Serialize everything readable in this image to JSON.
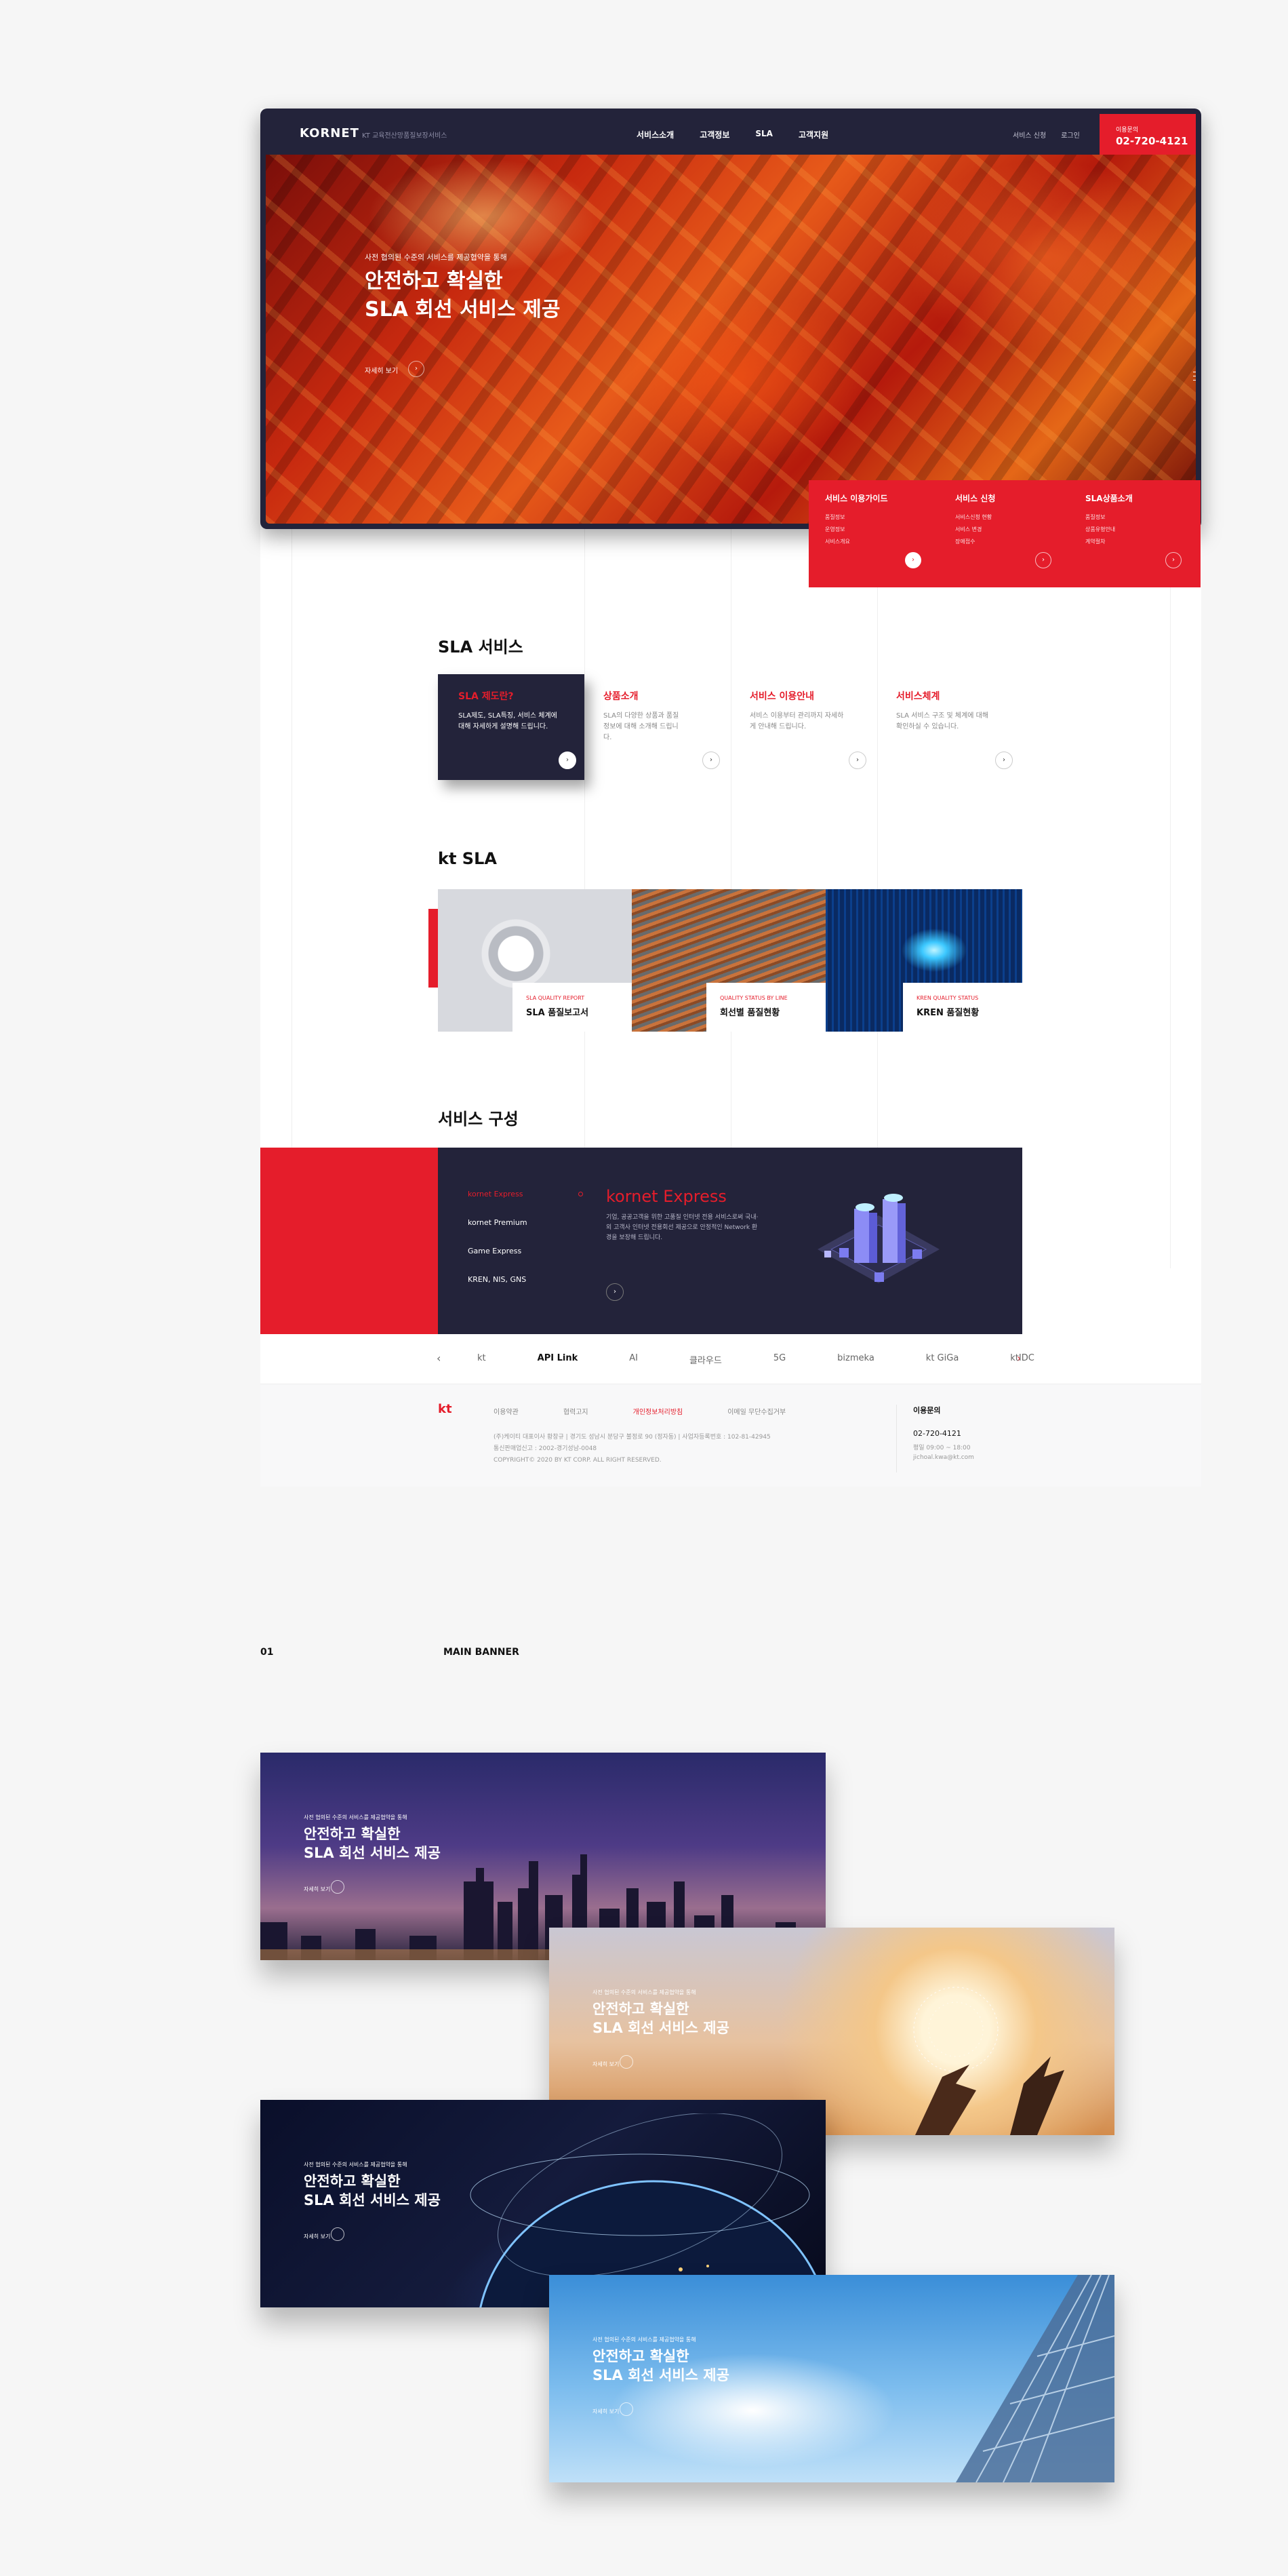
{
  "colors": {
    "accent": "#e51d2b",
    "navy": "#23233a"
  },
  "header": {
    "logo_text": "KORNET",
    "logo_sub": "KT 교육전산망품질보장서비스",
    "nav": [
      "서비스소개",
      "고객정보",
      "SLA",
      "고객지원"
    ],
    "util": [
      "서비스 신청",
      "로그인"
    ],
    "call_label": "이용문의",
    "call_number": "02-720-4121"
  },
  "hero": {
    "subtitle": "사전 협의된 수준의 서비스를 제공협약을 통해",
    "title": "안전하고 확실한\nSLA 회선 서비스 제공",
    "more": "자세히 보기"
  },
  "quick": [
    {
      "title": "서비스 이용가이드",
      "items": [
        "품질정보",
        "운영정보",
        "서비스개요"
      ]
    },
    {
      "title": "서비스 신청",
      "items": [
        "서비스신청 현황",
        "서비스 변경",
        "장애접수"
      ]
    },
    {
      "title": "SLA상품소개",
      "items": [
        "품질정보",
        "상품유형안내",
        "계약절차"
      ]
    }
  ],
  "sla": {
    "title": "SLA 서비스",
    "cards": [
      {
        "title": "SLA 제도란?",
        "desc": "SLA제도, SLA특징, 서비스 체계에 대해 자세하게 설명해 드립니다."
      },
      {
        "title": "상품소개",
        "desc": "SLA의 다양한 상품과 품질정보에 대해 소개해 드립니다."
      },
      {
        "title": "서비스 이용안내",
        "desc": "서비스 이용부터 관리까지 자세하게 안내해 드립니다."
      },
      {
        "title": "서비스체계",
        "desc": "SLA 서비스 구조 및 체계에 대해 확인하실 수 있습니다."
      }
    ]
  },
  "ktsla": {
    "title": "kt SLA",
    "tiles": [
      {
        "tag": "SLA QUALITY REPORT",
        "name": "SLA 품질보고서"
      },
      {
        "tag": "QUALITY STATUS BY LINE",
        "name": "회선별 품질현황"
      },
      {
        "tag": "KREN QUALITY STATUS",
        "name": "KREN 품질현황"
      }
    ]
  },
  "service": {
    "title": "서비스 구성",
    "menu": [
      "kornet Express",
      "kornet Premium",
      "Game Express",
      "KREN, NIS, GNS"
    ],
    "active_title": "kornet Express",
    "desc": "기업, 공공고객을 위한 고품질 인터넷 전용 서비스로써 국내·외 고객사 인터넷 전용회선 제공으로 안정적인 Network 환경을 보장해 드립니다."
  },
  "links": {
    "items": [
      "kt",
      "API Link",
      "AI",
      "클라우드",
      "5G",
      "bizmeka",
      "kt GiGa",
      "ktIDC"
    ],
    "prev": "‹",
    "next": "›"
  },
  "footer": {
    "logo": "kt",
    "nav": [
      "이용약관",
      "협력고지",
      "개인정보처리방침",
      "이메일 무단수집거부"
    ],
    "address": "(주)케이티 대표이사 황창규 | 경기도 성남시 분당구 불정로 90 (정자동) | 사업자등록번호 : 102-81-42945\n통신판매업신고 : 2002-경기성남-0048\nCOPYRIGHT© 2020 BY KT CORP. ALL RIGHT RESERVED.",
    "contact_title": "이용문의",
    "contact_phone": "02-720-4121",
    "contact_hours": "평일 09:00 ~ 18:00",
    "contact_mail": "jichoal.kwa@kt.com"
  },
  "showcase": {
    "index": "01",
    "label": "MAIN BANNER",
    "banner_sub": "사전 협의된 수준의 서비스를 제공협약을 통해",
    "banner_title": "안전하고 확실한\nSLA 회선 서비스 제공",
    "banner_more": "자세히 보기"
  }
}
